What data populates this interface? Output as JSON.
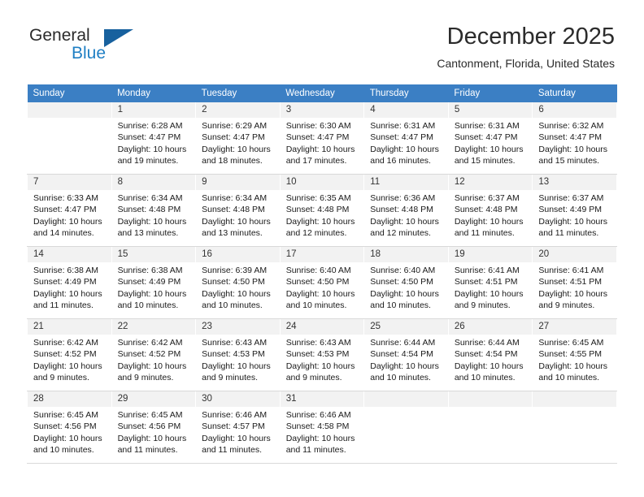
{
  "brand": {
    "name_part1": "General",
    "name_part2": "Blue",
    "logo_icon": "triangle-flag-icon"
  },
  "header": {
    "month_title": "December 2025",
    "location": "Cantonment, Florida, United States"
  },
  "colors": {
    "header_row_bg": "#3b7fc4",
    "daynum_bg": "#f2f2f2",
    "brand_blue": "#1f7fc4",
    "logo_blue": "#17619e",
    "cell_border": "#d9d9d9"
  },
  "calendar": {
    "weekday_headers": [
      "Sunday",
      "Monday",
      "Tuesday",
      "Wednesday",
      "Thursday",
      "Friday",
      "Saturday"
    ],
    "weeks": [
      [
        {
          "day": "",
          "blank": true,
          "sunrise": "",
          "sunset": "",
          "daylight1": "",
          "daylight2": ""
        },
        {
          "day": "1",
          "blank": false,
          "sunrise": "Sunrise: 6:28 AM",
          "sunset": "Sunset: 4:47 PM",
          "daylight1": "Daylight: 10 hours",
          "daylight2": "and 19 minutes."
        },
        {
          "day": "2",
          "blank": false,
          "sunrise": "Sunrise: 6:29 AM",
          "sunset": "Sunset: 4:47 PM",
          "daylight1": "Daylight: 10 hours",
          "daylight2": "and 18 minutes."
        },
        {
          "day": "3",
          "blank": false,
          "sunrise": "Sunrise: 6:30 AM",
          "sunset": "Sunset: 4:47 PM",
          "daylight1": "Daylight: 10 hours",
          "daylight2": "and 17 minutes."
        },
        {
          "day": "4",
          "blank": false,
          "sunrise": "Sunrise: 6:31 AM",
          "sunset": "Sunset: 4:47 PM",
          "daylight1": "Daylight: 10 hours",
          "daylight2": "and 16 minutes."
        },
        {
          "day": "5",
          "blank": false,
          "sunrise": "Sunrise: 6:31 AM",
          "sunset": "Sunset: 4:47 PM",
          "daylight1": "Daylight: 10 hours",
          "daylight2": "and 15 minutes."
        },
        {
          "day": "6",
          "blank": false,
          "sunrise": "Sunrise: 6:32 AM",
          "sunset": "Sunset: 4:47 PM",
          "daylight1": "Daylight: 10 hours",
          "daylight2": "and 15 minutes."
        }
      ],
      [
        {
          "day": "7",
          "blank": false,
          "sunrise": "Sunrise: 6:33 AM",
          "sunset": "Sunset: 4:47 PM",
          "daylight1": "Daylight: 10 hours",
          "daylight2": "and 14 minutes."
        },
        {
          "day": "8",
          "blank": false,
          "sunrise": "Sunrise: 6:34 AM",
          "sunset": "Sunset: 4:48 PM",
          "daylight1": "Daylight: 10 hours",
          "daylight2": "and 13 minutes."
        },
        {
          "day": "9",
          "blank": false,
          "sunrise": "Sunrise: 6:34 AM",
          "sunset": "Sunset: 4:48 PM",
          "daylight1": "Daylight: 10 hours",
          "daylight2": "and 13 minutes."
        },
        {
          "day": "10",
          "blank": false,
          "sunrise": "Sunrise: 6:35 AM",
          "sunset": "Sunset: 4:48 PM",
          "daylight1": "Daylight: 10 hours",
          "daylight2": "and 12 minutes."
        },
        {
          "day": "11",
          "blank": false,
          "sunrise": "Sunrise: 6:36 AM",
          "sunset": "Sunset: 4:48 PM",
          "daylight1": "Daylight: 10 hours",
          "daylight2": "and 12 minutes."
        },
        {
          "day": "12",
          "blank": false,
          "sunrise": "Sunrise: 6:37 AM",
          "sunset": "Sunset: 4:48 PM",
          "daylight1": "Daylight: 10 hours",
          "daylight2": "and 11 minutes."
        },
        {
          "day": "13",
          "blank": false,
          "sunrise": "Sunrise: 6:37 AM",
          "sunset": "Sunset: 4:49 PM",
          "daylight1": "Daylight: 10 hours",
          "daylight2": "and 11 minutes."
        }
      ],
      [
        {
          "day": "14",
          "blank": false,
          "sunrise": "Sunrise: 6:38 AM",
          "sunset": "Sunset: 4:49 PM",
          "daylight1": "Daylight: 10 hours",
          "daylight2": "and 11 minutes."
        },
        {
          "day": "15",
          "blank": false,
          "sunrise": "Sunrise: 6:38 AM",
          "sunset": "Sunset: 4:49 PM",
          "daylight1": "Daylight: 10 hours",
          "daylight2": "and 10 minutes."
        },
        {
          "day": "16",
          "blank": false,
          "sunrise": "Sunrise: 6:39 AM",
          "sunset": "Sunset: 4:50 PM",
          "daylight1": "Daylight: 10 hours",
          "daylight2": "and 10 minutes."
        },
        {
          "day": "17",
          "blank": false,
          "sunrise": "Sunrise: 6:40 AM",
          "sunset": "Sunset: 4:50 PM",
          "daylight1": "Daylight: 10 hours",
          "daylight2": "and 10 minutes."
        },
        {
          "day": "18",
          "blank": false,
          "sunrise": "Sunrise: 6:40 AM",
          "sunset": "Sunset: 4:50 PM",
          "daylight1": "Daylight: 10 hours",
          "daylight2": "and 10 minutes."
        },
        {
          "day": "19",
          "blank": false,
          "sunrise": "Sunrise: 6:41 AM",
          "sunset": "Sunset: 4:51 PM",
          "daylight1": "Daylight: 10 hours",
          "daylight2": "and 9 minutes."
        },
        {
          "day": "20",
          "blank": false,
          "sunrise": "Sunrise: 6:41 AM",
          "sunset": "Sunset: 4:51 PM",
          "daylight1": "Daylight: 10 hours",
          "daylight2": "and 9 minutes."
        }
      ],
      [
        {
          "day": "21",
          "blank": false,
          "sunrise": "Sunrise: 6:42 AM",
          "sunset": "Sunset: 4:52 PM",
          "daylight1": "Daylight: 10 hours",
          "daylight2": "and 9 minutes."
        },
        {
          "day": "22",
          "blank": false,
          "sunrise": "Sunrise: 6:42 AM",
          "sunset": "Sunset: 4:52 PM",
          "daylight1": "Daylight: 10 hours",
          "daylight2": "and 9 minutes."
        },
        {
          "day": "23",
          "blank": false,
          "sunrise": "Sunrise: 6:43 AM",
          "sunset": "Sunset: 4:53 PM",
          "daylight1": "Daylight: 10 hours",
          "daylight2": "and 9 minutes."
        },
        {
          "day": "24",
          "blank": false,
          "sunrise": "Sunrise: 6:43 AM",
          "sunset": "Sunset: 4:53 PM",
          "daylight1": "Daylight: 10 hours",
          "daylight2": "and 9 minutes."
        },
        {
          "day": "25",
          "blank": false,
          "sunrise": "Sunrise: 6:44 AM",
          "sunset": "Sunset: 4:54 PM",
          "daylight1": "Daylight: 10 hours",
          "daylight2": "and 10 minutes."
        },
        {
          "day": "26",
          "blank": false,
          "sunrise": "Sunrise: 6:44 AM",
          "sunset": "Sunset: 4:54 PM",
          "daylight1": "Daylight: 10 hours",
          "daylight2": "and 10 minutes."
        },
        {
          "day": "27",
          "blank": false,
          "sunrise": "Sunrise: 6:45 AM",
          "sunset": "Sunset: 4:55 PM",
          "daylight1": "Daylight: 10 hours",
          "daylight2": "and 10 minutes."
        }
      ],
      [
        {
          "day": "28",
          "blank": false,
          "sunrise": "Sunrise: 6:45 AM",
          "sunset": "Sunset: 4:56 PM",
          "daylight1": "Daylight: 10 hours",
          "daylight2": "and 10 minutes."
        },
        {
          "day": "29",
          "blank": false,
          "sunrise": "Sunrise: 6:45 AM",
          "sunset": "Sunset: 4:56 PM",
          "daylight1": "Daylight: 10 hours",
          "daylight2": "and 11 minutes."
        },
        {
          "day": "30",
          "blank": false,
          "sunrise": "Sunrise: 6:46 AM",
          "sunset": "Sunset: 4:57 PM",
          "daylight1": "Daylight: 10 hours",
          "daylight2": "and 11 minutes."
        },
        {
          "day": "31",
          "blank": false,
          "sunrise": "Sunrise: 6:46 AM",
          "sunset": "Sunset: 4:58 PM",
          "daylight1": "Daylight: 10 hours",
          "daylight2": "and 11 minutes."
        },
        {
          "day": "",
          "blank": true,
          "sunrise": "",
          "sunset": "",
          "daylight1": "",
          "daylight2": ""
        },
        {
          "day": "",
          "blank": true,
          "sunrise": "",
          "sunset": "",
          "daylight1": "",
          "daylight2": ""
        },
        {
          "day": "",
          "blank": true,
          "sunrise": "",
          "sunset": "",
          "daylight1": "",
          "daylight2": ""
        }
      ]
    ]
  }
}
